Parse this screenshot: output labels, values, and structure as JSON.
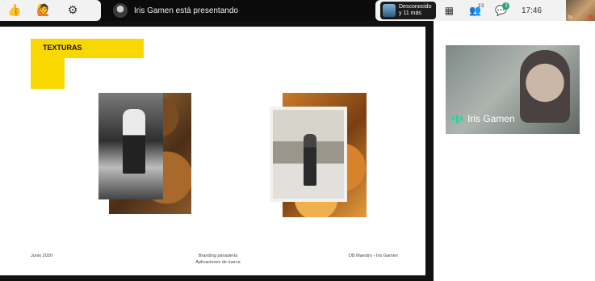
{
  "toolbar_left": {
    "reactions_icon": "thumbs-up-icon",
    "raise_hand_icon": "raised-hand-icon",
    "settings_icon": "gear-icon"
  },
  "presenter": {
    "text": "Iris Gamen está presentando"
  },
  "participant_preview": {
    "line1": "Desconocido",
    "line2": "y 11 más"
  },
  "toolbar_right": {
    "grid_icon": "grid-icon",
    "people_icon": "people-icon",
    "people_count": "23",
    "chat_icon": "chat-icon",
    "chat_badge": "3",
    "time": "17:46",
    "self_label": "Tú"
  },
  "slide": {
    "title": "TEXTURAS",
    "footer_left": "Junio 2020",
    "footer_center_line1": "Branding panadería",
    "footer_center_line2": "Aplicaciones de marca",
    "footer_right": "DB Maestro - Iris Gamen"
  },
  "speaker": {
    "name": "Iris Gamen"
  },
  "colors": {
    "accent_yellow": "#f8d800",
    "speaking_green": "#2ed3a0",
    "badge_green": "#23a26d"
  }
}
